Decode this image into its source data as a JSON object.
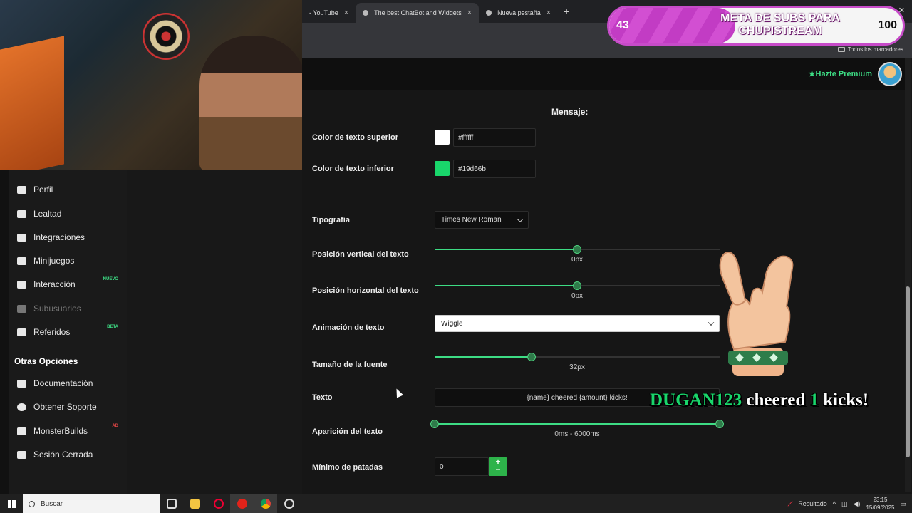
{
  "browser": {
    "tabs": [
      {
        "title": "- YouTube",
        "active": false
      },
      {
        "title": "The best ChatBot and Widgets",
        "active": true
      },
      {
        "title": "Nueva pestaña",
        "active": false
      }
    ],
    "bookmarks_label": "Todos los marcadores"
  },
  "overlay": {
    "sub_goal": {
      "current": "43",
      "title": "META DE SUBS PARA CHUPISTREAM",
      "target": "100",
      "progress": 0.43
    },
    "alert": {
      "name": "DUGAN123",
      "word1": "cheered",
      "amount": "1",
      "word2": "kicks!"
    }
  },
  "header": {
    "premium_label": "Hazte Premium"
  },
  "sidebar": {
    "items": [
      {
        "label": "Perfil",
        "icon": "profile-card-icon"
      },
      {
        "label": "Lealtad",
        "icon": "trophy-icon"
      },
      {
        "label": "Integraciones",
        "icon": "puzzle-icon"
      },
      {
        "label": "Minijuegos",
        "icon": "gamepad-icon"
      },
      {
        "label": "Interacción",
        "icon": "music-note-icon",
        "badge": "NUEVO"
      },
      {
        "label": "Subusuarios",
        "icon": "users-icon",
        "muted": true
      },
      {
        "label": "Referidos",
        "icon": "referrals-icon",
        "badge": "BETA"
      }
    ],
    "section_title": "Otras Opciones",
    "other_items": [
      {
        "label": "Documentación",
        "icon": "book-icon"
      },
      {
        "label": "Obtener Soporte",
        "icon": "help-icon"
      },
      {
        "label": "MonsterBuilds",
        "icon": "laptop-icon",
        "badge": "AD"
      },
      {
        "label": "Sesión Cerrada",
        "icon": "logout-icon"
      }
    ]
  },
  "form": {
    "section_title": "Mensaje:",
    "top_color": {
      "label": "Color de texto superior",
      "value": "#ffffff"
    },
    "bottom_color": {
      "label": "Color de texto inferior",
      "value": "#19d66b"
    },
    "font": {
      "label": "Tipografía",
      "value": "Times New Roman"
    },
    "vertical_pos": {
      "label": "Posición vertical del texto",
      "value": "0px",
      "fraction": 0.5
    },
    "horizontal_pos": {
      "label": "Posición horizontal del texto",
      "value": "0px",
      "fraction": 0.5
    },
    "animation": {
      "label": "Animación de texto",
      "value": "Wiggle"
    },
    "font_size": {
      "label": "Tamaño de la fuente",
      "value": "32px",
      "fraction": 0.34
    },
    "text": {
      "label": "Texto",
      "value": "{name} cheered {amount} kicks!"
    },
    "appearance": {
      "label": "Aparición del texto",
      "value": "0ms - 6000ms",
      "range": [
        0,
        1
      ]
    },
    "min_kicks": {
      "label": "Mínimo de patadas",
      "value": "0"
    }
  },
  "taskbar": {
    "search_placeholder": "Buscar",
    "weather": "Resultado",
    "time": "23:15",
    "date": "15/09/2025"
  },
  "colors": {
    "accent": "#3ddc84",
    "alert_green": "#19d66b",
    "goal_pink": "#c74bc9"
  }
}
